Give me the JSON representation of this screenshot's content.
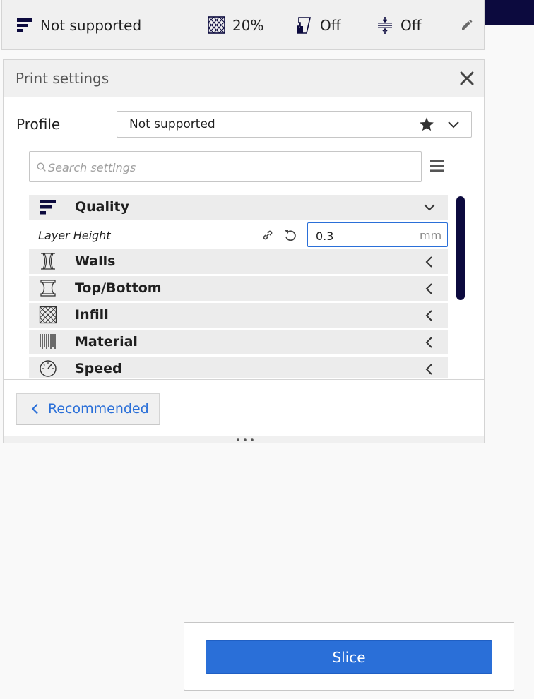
{
  "topbar": {
    "profile_label": "Not supported",
    "infill_value": "20%",
    "support_value": "Off",
    "adhesion_value": "Off"
  },
  "print_settings": {
    "title": "Print settings",
    "profile_label": "Profile",
    "profile_value": "Not supported",
    "search_placeholder": "Search settings",
    "categories": [
      {
        "name": "Quality",
        "icon": "quality-icon",
        "expanded": true
      },
      {
        "name": "Walls",
        "icon": "walls-icon",
        "expanded": false
      },
      {
        "name": "Top/Bottom",
        "icon": "top-bottom-icon",
        "expanded": false
      },
      {
        "name": "Infill",
        "icon": "infill-icon",
        "expanded": false
      },
      {
        "name": "Material",
        "icon": "material-icon",
        "expanded": false
      },
      {
        "name": "Speed",
        "icon": "speed-icon",
        "expanded": false
      }
    ],
    "layer_height": {
      "label": "Layer Height",
      "value": "0.3",
      "unit": "mm"
    },
    "recommended_label": "Recommended"
  },
  "slice_label": "Slice",
  "colors": {
    "accent": "#2a6fd8",
    "navy": "#0c0a3e",
    "panel_bg": "#f0f0f0"
  }
}
